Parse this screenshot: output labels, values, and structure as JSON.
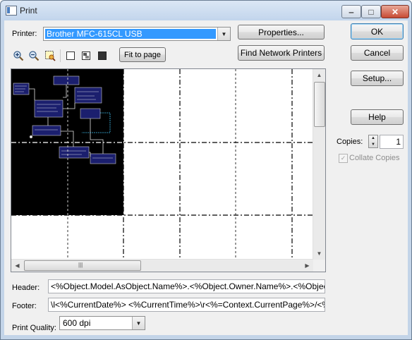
{
  "window": {
    "title": "Print"
  },
  "printer": {
    "label": "Printer:",
    "selected": "Brother MFC-615CL USB"
  },
  "buttons": {
    "properties": "Properties...",
    "find_network": "Find Network Printers",
    "fit_to_page": "Fit to page",
    "ok": "OK",
    "cancel": "Cancel",
    "setup": "Setup...",
    "help": "Help"
  },
  "toolbar": {
    "icons": [
      "zoom-in-icon",
      "zoom-out-icon",
      "zoom-area-icon",
      "page-white-icon",
      "page-mixed-icon",
      "page-black-icon"
    ]
  },
  "copies": {
    "label": "Copies:",
    "value": "1"
  },
  "collate": {
    "label": "Collate Copies",
    "checked": true,
    "enabled": false
  },
  "header": {
    "label": "Header:",
    "value": "<%Object.Model.AsObject.Name%>.<%Object.Owner.Name%>.<%Object.Name%>"
  },
  "footer": {
    "label": "Footer:",
    "value": "\\l<%CurrentDate%> <%CurrentTime%>\\r<%=Context.CurrentPage%>/<%=Context.TotalPages%>"
  },
  "quality": {
    "label": "Print Quality:",
    "selected": "600 dpi"
  },
  "colors": {
    "selection": "#3399ff",
    "client": "#f0f0f0",
    "preview_page": "#000000"
  }
}
